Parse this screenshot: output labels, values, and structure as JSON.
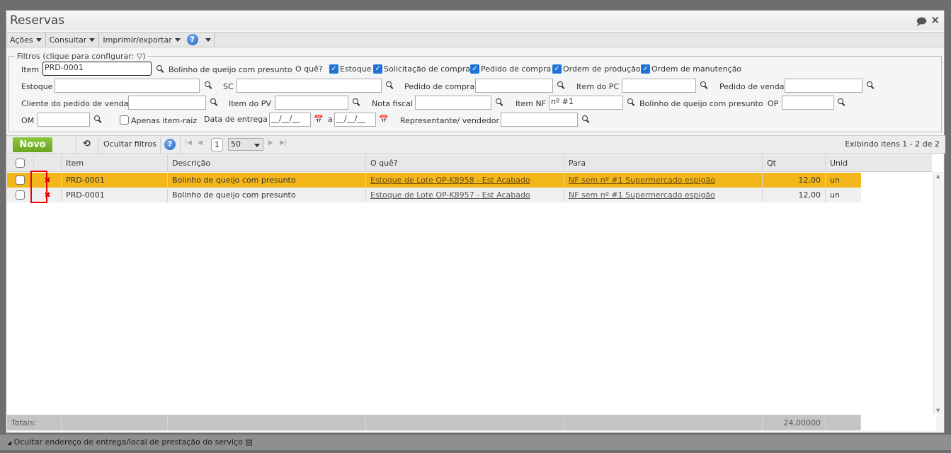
{
  "window": {
    "title": "Reservas"
  },
  "toolbar": {
    "acoes": "Ações",
    "consultar": "Consultar",
    "imprimir": "Imprimir/exportar",
    "help": "?"
  },
  "filters": {
    "legend": "Filtros (clique para configurar:",
    "legend_end": ")",
    "item_label": "Item",
    "item_value": "PRD-0001",
    "item_desc": "Bolinho de queijo com presunto",
    "oque_label": "O quê?",
    "checks": [
      "Estoque",
      "Solicitação de compra",
      "Pedido de compra",
      "Ordem de produção",
      "Ordem de manutenção"
    ],
    "estoque": "Estoque",
    "sc": "SC",
    "pedido_compra": "Pedido de compra",
    "item_pc": "Item do PC",
    "pedido_venda": "Pedido de venda",
    "cliente_pv": "Cliente do pedido de venda",
    "item_pv": "Item do PV",
    "nota_fiscal": "Nota fiscal",
    "item_nf": "Item NF",
    "item_nf_value": "nº  #1",
    "item_nf_desc": "Bolinho de queijo com presunto",
    "op": "OP",
    "om": "OM",
    "apenas_raiz": "Apenas item-raiz",
    "data_entrega": "Data de entrega",
    "date_from": "__/__/__",
    "a": "a",
    "date_to": "__/__/__",
    "representante": "Representante/ vendedor"
  },
  "gridbar": {
    "novo": "Novo",
    "ocultar": "Ocultar filtros",
    "page": "1",
    "page_size": "50",
    "exibindo": "Exibindo itens 1 - 2 de 2"
  },
  "grid": {
    "columns": [
      "Item",
      "Descrição",
      "O quê?",
      "Para",
      "Qt",
      "Unid"
    ],
    "rows": [
      {
        "item": "PRD-0001",
        "descricao": "Bolinho de queijo com presunto",
        "oque": "Estoque de Lote OP-K8958 - Est Acabado",
        "para": "NF sem nº #1 Supermercado espigão",
        "qt": "12,00",
        "unid": "un"
      },
      {
        "item": "PRD-0001",
        "descricao": "Bolinho de queijo com presunto",
        "oque": "Estoque de Lote OP-K8957 - Est Acabado",
        "para": "NF sem nº #1 Supermercado espigão",
        "qt": "12,00",
        "unid": "un"
      }
    ],
    "totais_label": "Totais:",
    "totais_qt": "24,00000"
  },
  "footer": {
    "text": "Ocultar endereço de entrega/local de prestação do serviço"
  }
}
